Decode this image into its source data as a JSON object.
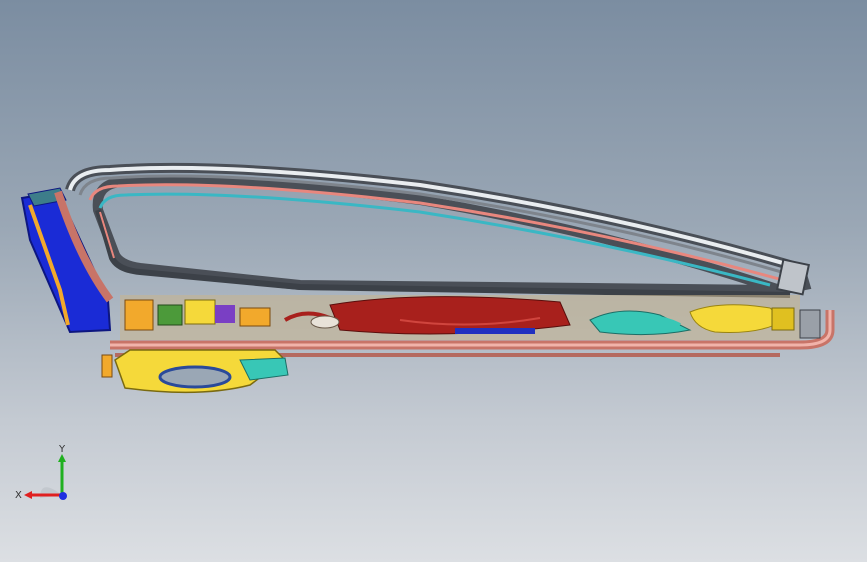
{
  "viewport": {
    "background_top": "#7b8da1",
    "background_bottom": "#dcdfe3"
  },
  "model": {
    "name": "",
    "colors": {
      "frame_outer": "#5a5f66",
      "frame_highlight": "#e8ecef",
      "seal_pink": "#e8877e",
      "seal_cyan": "#3ab7c4",
      "blue_trim": "#1a2bd6",
      "orange_trim": "#f2a92c",
      "yellow_part": "#f5d93a",
      "red_module": "#a8201c",
      "teal_part": "#38c7b6",
      "rail_salmon": "#d98a7e"
    }
  },
  "triad": {
    "x_label": "X",
    "y_label": "Y",
    "x_color": "#e02020",
    "y_color": "#20b020",
    "z_color": "#2030e0"
  }
}
